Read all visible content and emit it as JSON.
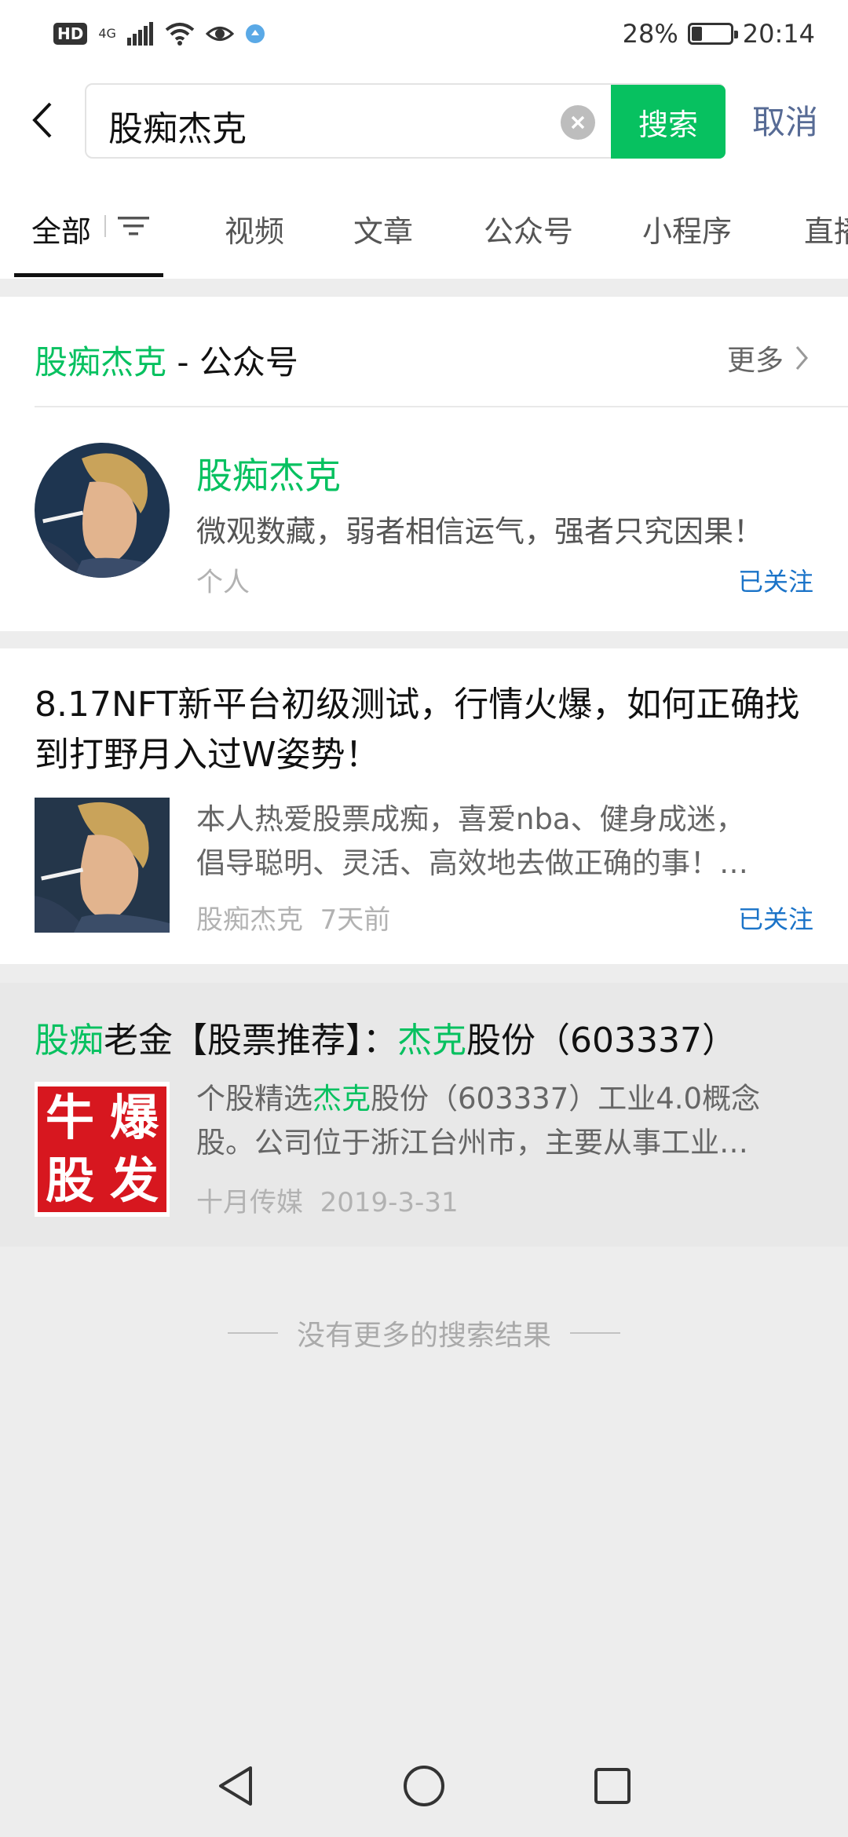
{
  "status_bar": {
    "network_label": "HD",
    "signal_label": "4G",
    "battery_percent": "28%",
    "battery_level": 0.28,
    "time": "20:14"
  },
  "search": {
    "query": "股痴杰克",
    "search_button": "搜索",
    "cancel_button": "取消"
  },
  "tabs": [
    {
      "label": "全部",
      "active": true
    },
    {
      "label": "视频"
    },
    {
      "label": "文章"
    },
    {
      "label": "公众号"
    },
    {
      "label": "小程序"
    },
    {
      "label": "直播"
    }
  ],
  "account_section": {
    "heading_highlight": "股痴杰克",
    "heading_rest": " - 公众号",
    "more_label": "更多",
    "account": {
      "name": "股痴杰克",
      "description": "微观数藏，弱者相信运气，强者只究因果！",
      "type": "个人",
      "follow_status": "已关注"
    }
  },
  "articles": [
    {
      "title": "8.17NFT新平台初级测试，行情火爆，如何正确找到打野月入过W姿势！",
      "desc_line1": "本人热爱股票成痴，喜爱nba、健身成迷，",
      "desc_line2": "倡导聪明、灵活、高效地去做正确的事！…",
      "source": "股痴杰克",
      "time": "7天前",
      "follow_status": "已关注"
    },
    {
      "title_hl1": "股痴",
      "title_part2": "老金【股票推荐】：",
      "title_hl2": "杰克",
      "title_part4": "股份（603337）",
      "desc_part1": "个股精选",
      "desc_hl": "杰克",
      "desc_part2": "股份（603337）工业4.0概念",
      "desc_line2": "股。公司位于浙江台州市，主要从事工业…",
      "thumb_text": [
        "牛",
        "爆",
        "股",
        "发"
      ],
      "source": "十月传媒",
      "time": "2019-3-31"
    }
  ],
  "footer": {
    "no_more_results": "没有更多的搜索结果"
  },
  "colors": {
    "accent": "#07c160",
    "link": "#576b95",
    "follow": "#1a73c8"
  }
}
